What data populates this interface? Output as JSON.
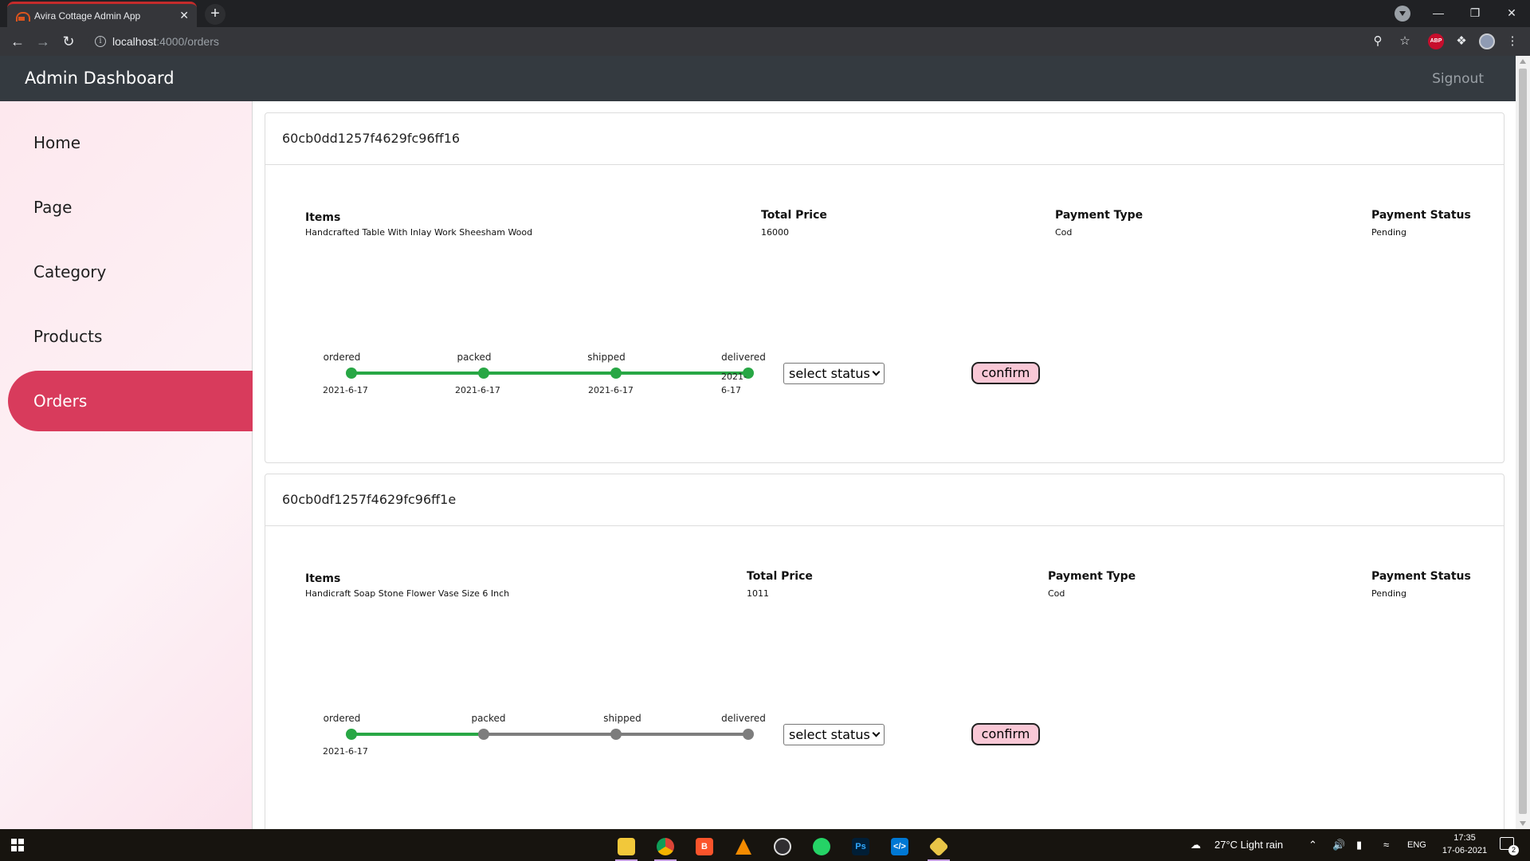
{
  "browser": {
    "tab_title": "Avira Cottage Admin App",
    "tab_close": "✕",
    "new_tab": "+",
    "url_host": "localhost",
    "url_path": ":4000/orders",
    "info_glyph": "i"
  },
  "header": {
    "brand": "Admin Dashboard",
    "signout": "Signout"
  },
  "sidebar": {
    "items": [
      {
        "label": "Home",
        "active": false
      },
      {
        "label": "Page",
        "active": false
      },
      {
        "label": "Category",
        "active": false
      },
      {
        "label": "Products",
        "active": false
      },
      {
        "label": "Orders",
        "active": true
      }
    ]
  },
  "orders": [
    {
      "id": "60cb0dd1257f4629fc96ff16",
      "items_label": "Items",
      "items_value": "Handcrafted Table With Inlay Work Sheesham Wood",
      "price_label": "Total Price",
      "price_value": "16000",
      "ptype_label": "Payment Type",
      "ptype_value": "Cod",
      "pstatus_label": "Payment Status",
      "pstatus_value": "Pending",
      "steps": [
        {
          "name": "ordered",
          "date": "2021-6-17",
          "done": true
        },
        {
          "name": "packed",
          "date": "2021-6-17",
          "done": true
        },
        {
          "name": "shipped",
          "date": "2021-6-17",
          "done": true
        },
        {
          "name": "delivered",
          "date": "2021-6-17",
          "done": true
        }
      ],
      "select_label": "select status",
      "confirm_label": "confirm"
    },
    {
      "id": "60cb0df1257f4629fc96ff1e",
      "items_label": "Items",
      "items_value": "Handicraft Soap Stone Flower Vase Size 6 Inch",
      "price_label": "Total Price",
      "price_value": "1011",
      "ptype_label": "Payment Type",
      "ptype_value": "Cod",
      "pstatus_label": "Payment Status",
      "pstatus_value": "Pending",
      "steps": [
        {
          "name": "ordered",
          "date": "2021-6-17",
          "done": true
        },
        {
          "name": "packed",
          "date": "",
          "done": false
        },
        {
          "name": "shipped",
          "date": "",
          "done": false
        },
        {
          "name": "delivered",
          "date": "",
          "done": false
        }
      ],
      "select_label": "select status",
      "confirm_label": "confirm"
    }
  ],
  "taskbar": {
    "weather": "27°C  Light rain",
    "language": "ENG",
    "time": "17:35",
    "date": "17-06-2021",
    "notifications": "2",
    "apps": [
      "file-explorer",
      "chrome",
      "brave",
      "vlc",
      "obs",
      "whatsapp",
      "photoshop",
      "vscode",
      "git"
    ]
  },
  "colors": {
    "header_bg": "#343a40",
    "active_nav": "#d83b5c",
    "progress_done": "#28a745",
    "progress_pending": "#7d7d7d",
    "confirm_bg": "#f9c8d6"
  }
}
